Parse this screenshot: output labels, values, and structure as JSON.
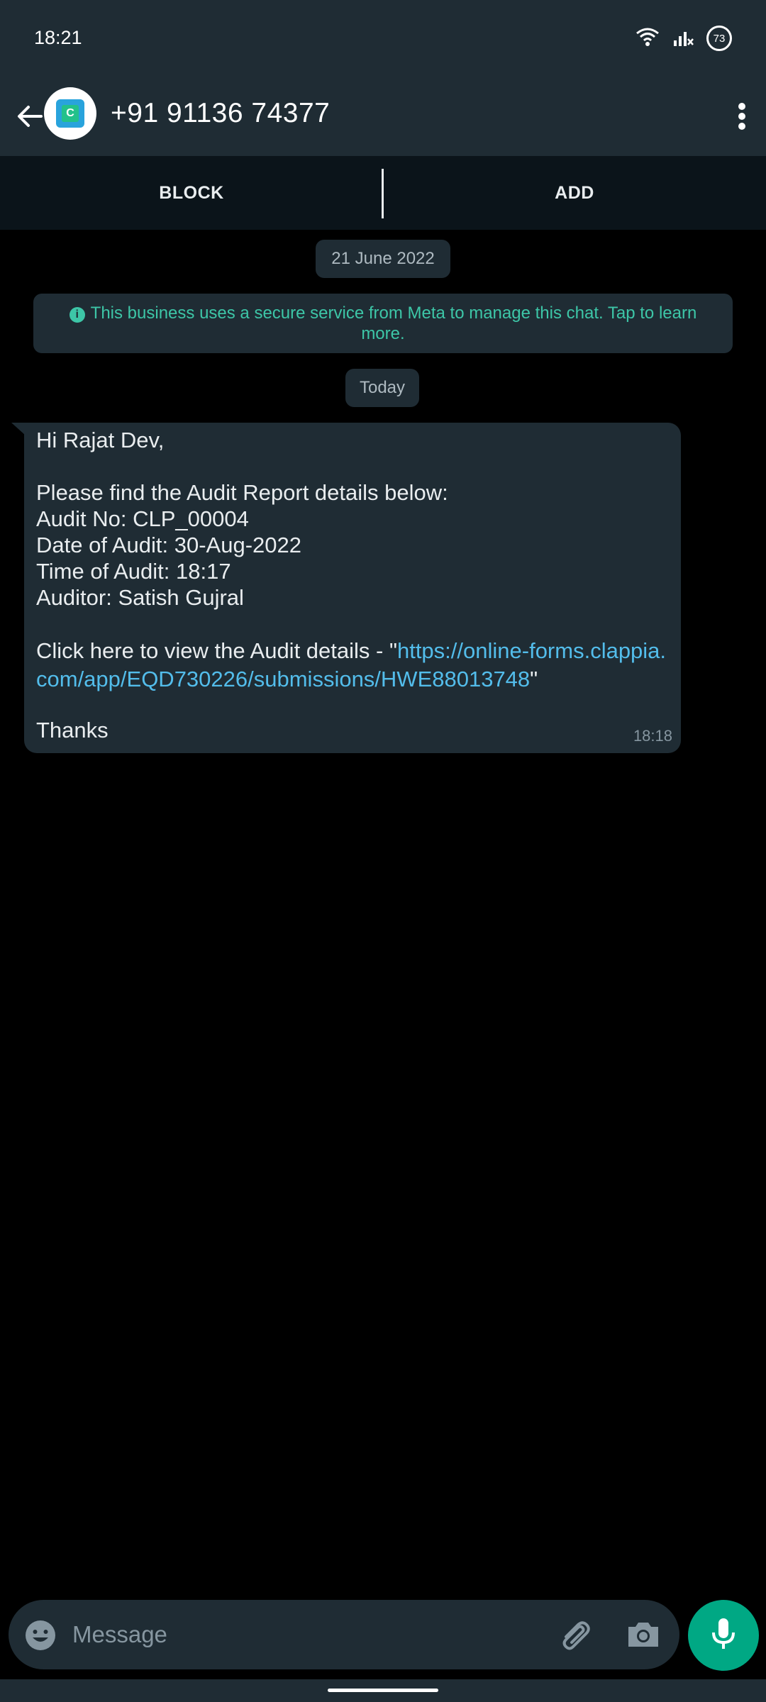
{
  "status_bar": {
    "time": "18:21",
    "battery": "73",
    "icons": [
      "wifi-icon",
      "signal-icon",
      "battery-icon"
    ]
  },
  "header": {
    "contact": "+91 91136 74377",
    "avatar_letter": "C",
    "icons": [
      "back-arrow-icon",
      "more-vertical-icon"
    ]
  },
  "actions": {
    "block": "BLOCK",
    "add": "ADD"
  },
  "chat": {
    "date_chip": "21 June 2022",
    "notice": "This business uses a secure service from Meta to manage this chat. Tap to learn more.",
    "today_chip": "Today",
    "message": {
      "greeting": "Hi Rajat Dev,",
      "intro": "Please find the Audit Report details below:",
      "audit_no": "Audit No: CLP_00004",
      "date": "Date of Audit: 30-Aug-2022",
      "time_of_audit": "Time of Audit: 18:17",
      "auditor": "Auditor: Satish Gujral",
      "link_prefix": "Click here to view the Audit details - \"",
      "link": "https://online-forms.clappia.com/app/EQD730226/submissions/HWE88013748",
      "link_suffix": "\"",
      "closing": "Thanks",
      "timestamp": "18:18"
    }
  },
  "composer": {
    "placeholder": "Message",
    "icons": [
      "emoji-icon",
      "attach-icon",
      "camera-icon",
      "mic-icon"
    ]
  },
  "colors": {
    "header_bg": "#1f2c34",
    "bubble_bg": "#1f2c34",
    "accent": "#00a884",
    "link": "#53bdeb",
    "notice_text": "#3dc6a7"
  }
}
